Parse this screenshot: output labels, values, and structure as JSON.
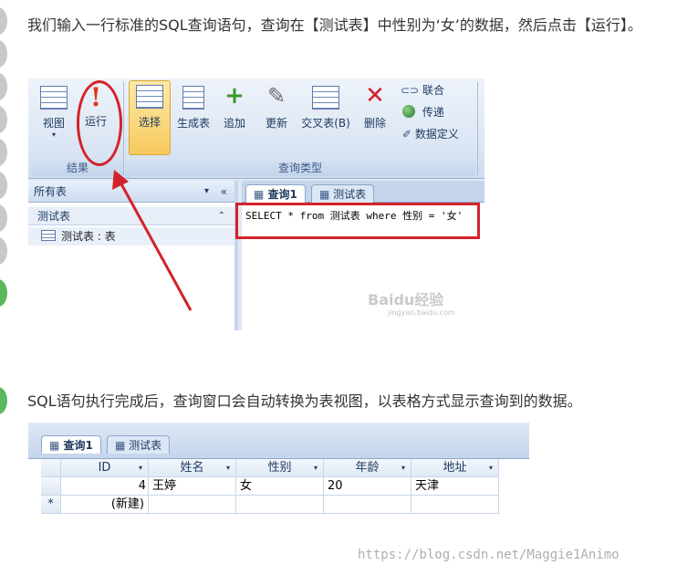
{
  "step1": {
    "text": "我们输入一行标准的SQL查询语句，查询在【测试表】中性别为‘女’的数据，然后点击【运行】。"
  },
  "ribbon": {
    "view_label": "视图",
    "run_label": "运行",
    "results_group": "结果",
    "select_label": "选择",
    "make_table_label": "生成表",
    "append_label": "追加",
    "update_label": "更新",
    "crosstab_label": "交叉表(B)",
    "delete_label": "删除",
    "union_label": "联合",
    "passthrough_label": "传递",
    "data_def_label": "数据定义",
    "query_type_group": "查询类型"
  },
  "nav": {
    "header": "所有表",
    "group": "测试表",
    "item": "测试表 : 表"
  },
  "editor": {
    "tab_query": "查询1",
    "tab_table": "测试表",
    "sql": "SELECT * from 测试表 where 性别 = '女'",
    "watermark": "Baidu经验",
    "watermark_url": "jingyan.baidu.com"
  },
  "step2": {
    "text": "SQL语句执行完成后，查询窗口会自动转换为表视图，以表格方式显示查询到的数据。"
  },
  "datasheet": {
    "tab_query": "查询1",
    "tab_table": "测试表",
    "columns": [
      "ID",
      "姓名",
      "性别",
      "年龄",
      "地址"
    ],
    "row": [
      "4",
      "王婷",
      "女",
      "20",
      "天津"
    ],
    "new_row_label": "(新建)",
    "new_row_marker": "*"
  },
  "footer": {
    "watermark": "https://blog.csdn.net/Maggie1Animo"
  },
  "colors": {
    "highlight_red": "#d3222a",
    "ribbon_blue": "#dbe5f3",
    "step_green": "#5cb85c"
  }
}
